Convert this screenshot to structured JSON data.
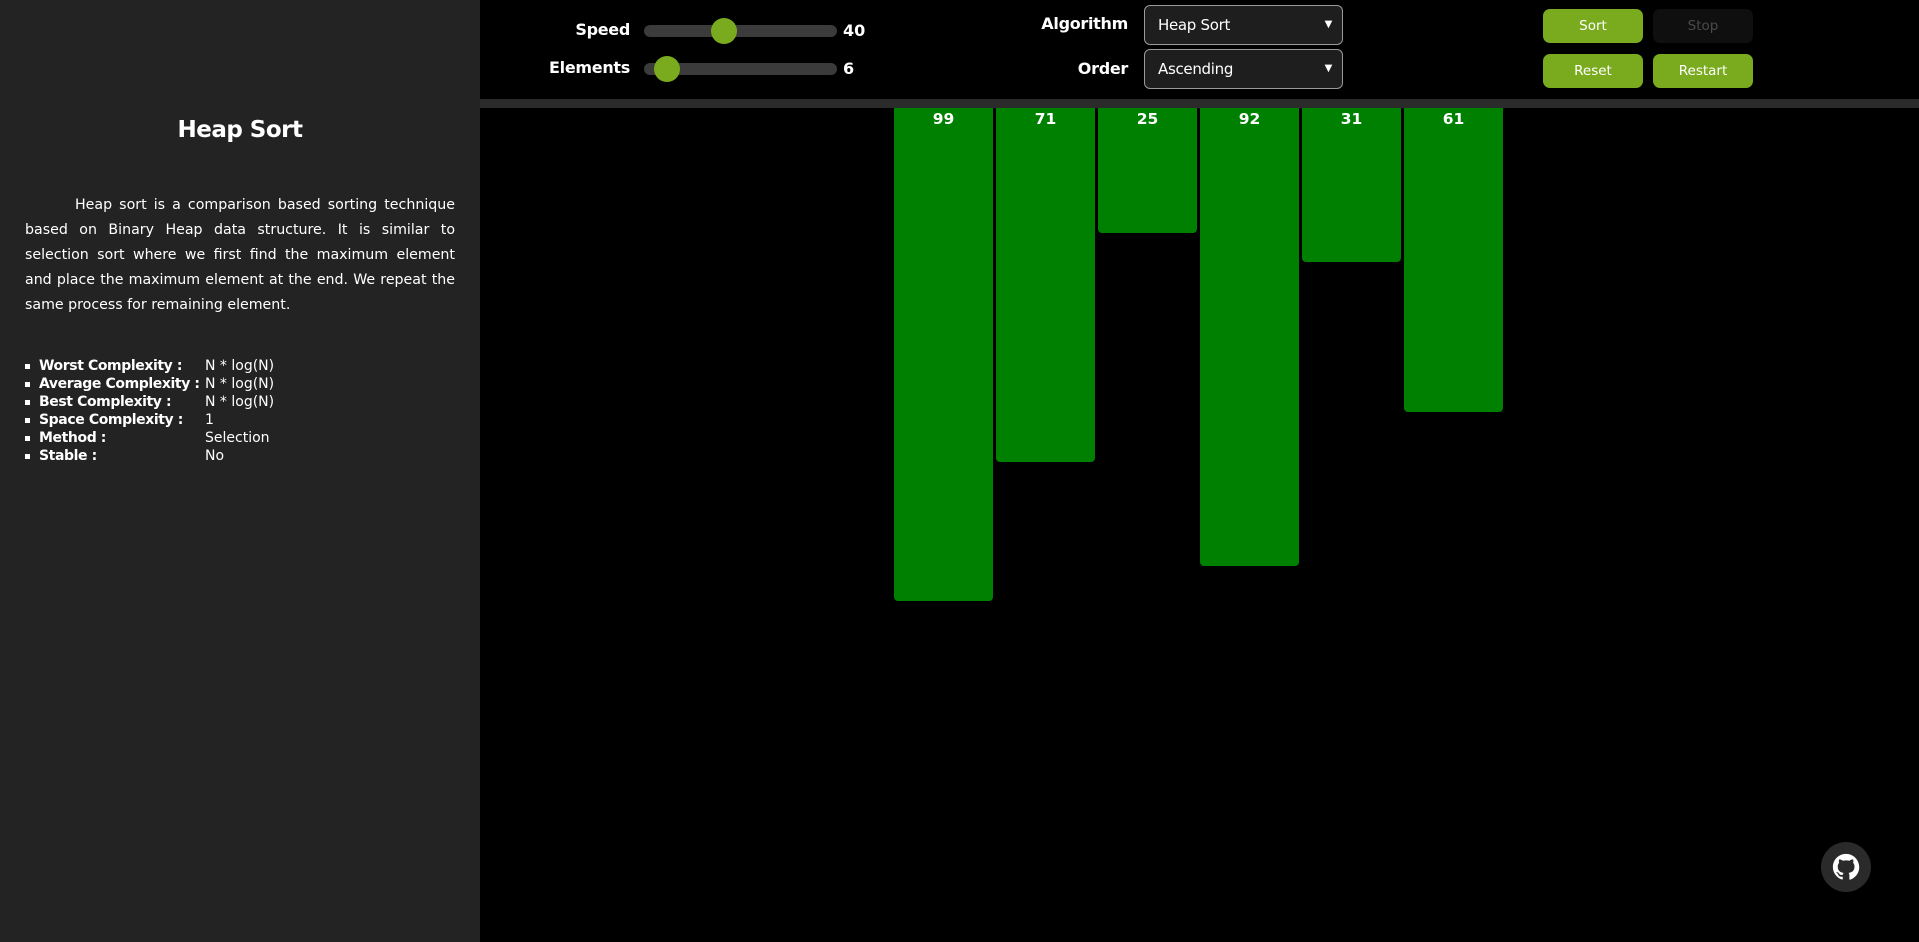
{
  "sidebar": {
    "title": "Heap Sort",
    "description": "Heap sort is a comparison based sorting technique based on Binary Heap data structure. It is similar to selection sort where we first find the maximum element and place the maximum element at the end. We repeat the same process for remaining element.",
    "info": [
      {
        "key": "Worst Complexity :",
        "value": "N * log(N)"
      },
      {
        "key": "Average Complexity :",
        "value": "N * log(N)"
      },
      {
        "key": "Best Complexity :",
        "value": "N * log(N)"
      },
      {
        "key": "Space Complexity :",
        "value": "1"
      },
      {
        "key": "Method :",
        "value": "Selection"
      },
      {
        "key": "Stable :",
        "value": "No"
      }
    ]
  },
  "controls": {
    "speed_label": "Speed",
    "speed_value": "40",
    "speed_level": 0.4,
    "elements_label": "Elements",
    "elements_value": "6",
    "elements_level": 0.06,
    "algorithm_label": "Algorithm",
    "algorithm_selected": "Heap Sort",
    "order_label": "Order",
    "order_selected": "Ascending"
  },
  "buttons": {
    "sort": "Sort",
    "stop": "Stop",
    "reset": "Reset",
    "restart": "Restart"
  },
  "array": [
    99,
    71,
    25,
    92,
    31,
    61
  ],
  "colors": {
    "bar": "#008000",
    "accent": "#7aab1f",
    "sidebar_bg": "#232323"
  },
  "icons": {
    "github": "github-icon",
    "select_chevron": "chevron-down-icon"
  }
}
